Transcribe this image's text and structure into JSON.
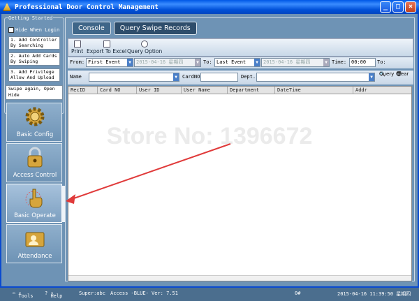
{
  "window": {
    "title": "Professional Door Control Management",
    "buttons": [
      "_",
      "□",
      "×"
    ]
  },
  "getting_started": {
    "title": "Getting Started",
    "hide_when_login": "Hide When Login",
    "steps": [
      "1. Add Controller\nBy Searching",
      "2. Auto Add Cards\nBy Swiping",
      "3. Add Privilege\nAllow And Upload"
    ],
    "swipe_again": "Swipe again, Open\nHide"
  },
  "nav": [
    {
      "label": "Basic Config",
      "icon": "gear-icon"
    },
    {
      "label": "Access Control",
      "icon": "lock-icon"
    },
    {
      "label": "Basic Operate",
      "icon": "hand-pointer-icon",
      "active": true
    },
    {
      "label": "Attendance",
      "icon": "person-card-icon"
    }
  ],
  "tabs": [
    "Console",
    "Query Swipe Records"
  ],
  "toolbar": {
    "print": "Print",
    "export": "Export To Excel",
    "query_option": "Query Option"
  },
  "filters": {
    "from_label": "From:",
    "from_value": "First Event",
    "from_date": "2015-04-16 星期四",
    "to_label": "To:",
    "to_value": "Last Event",
    "to_date": "2015-04-16 星期四",
    "time_label": "Time:",
    "time_value": "00:00",
    "to2_label": "To:",
    "name_label": "Name",
    "cardno_label": "CardNO",
    "dept_label": "Dept.",
    "query": "Query",
    "clear": "Clear"
  },
  "grid": {
    "columns": [
      "RecID",
      "Card NO",
      "User ID",
      "User Name",
      "Department",
      "DateTime",
      "Addr"
    ]
  },
  "watermark": "Store No: 1396672",
  "status": {
    "tools": "Tools",
    "help": "Help",
    "user": "Super:abc",
    "version": "Access -BLUE- Ver: 7.51",
    "count": "0#",
    "datetime": "2015-04-16 11:39:50 星期四"
  },
  "colors": {
    "accent_arrow": "#e03a3a"
  }
}
